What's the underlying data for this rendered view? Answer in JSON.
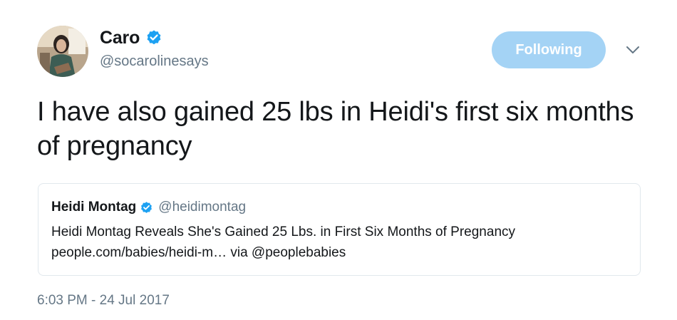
{
  "author": {
    "display_name": "Caro",
    "handle": "@socarolinesays",
    "verified": true,
    "avatar_icon": "profile-photo"
  },
  "follow_button": {
    "label": "Following",
    "color": "#a4d3f5"
  },
  "menu": {
    "icon": "chevron-down-icon"
  },
  "tweet": {
    "text": "I have also gained 25 lbs in Heidi's first six months of pregnancy",
    "timestamp": "6:03 PM - 24 Jul 2017"
  },
  "quoted_tweet": {
    "display_name": "Heidi Montag",
    "handle": "@heidimontag",
    "verified": true,
    "line1": "Heidi Montag Reveals She's Gained 25 Lbs. in First Six Months of Pregnancy",
    "line2": "people.com/babies/heidi-m… via @peoplebabies"
  },
  "colors": {
    "verified_blue": "#1da1f2",
    "text_primary": "#14171a",
    "text_secondary": "#657786",
    "border": "#e1e8ed"
  }
}
